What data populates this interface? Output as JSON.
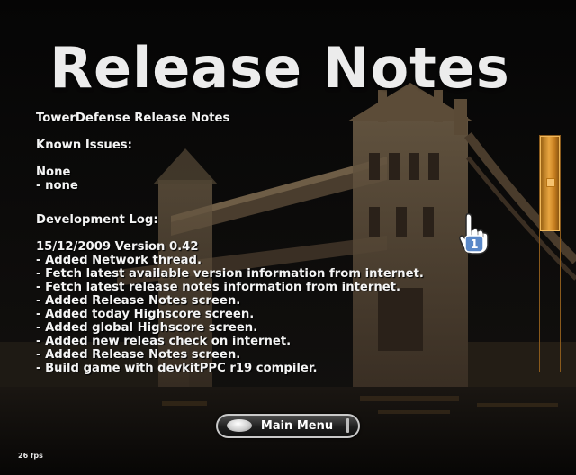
{
  "screen": {
    "title": "Release Notes"
  },
  "notes": {
    "heading": "TowerDefense Release Notes",
    "known_issues_label": "Known Issues:",
    "known_issues_lines": [
      "None",
      "- none"
    ],
    "development_log_label": "Development Log:",
    "version_line": "15/12/2009 Version 0.42",
    "changes": [
      "- Added Network thread.",
      "- Fetch latest available version information from internet.",
      "- Fetch latest release notes information from internet.",
      "- Added Release Notes screen.",
      "- Added today Highscore screen.",
      "- Added global Highscore screen.",
      "- Added new releas check on internet.",
      "- Added Release Notes screen.",
      "- Build game with devkitPPC r19 compiler."
    ]
  },
  "main_menu_button": {
    "label": "Main Menu"
  },
  "cursor": {
    "icon": "pointing-hand-cursor-icon",
    "player_number": "1"
  },
  "fps": "26 fps",
  "scrollbar": {
    "position": 0
  },
  "colors": {
    "text": "#f4f4f4",
    "scrollbar_accent": "#e9a640",
    "cursor_badge": "#5a88c8",
    "background": "#000000"
  }
}
